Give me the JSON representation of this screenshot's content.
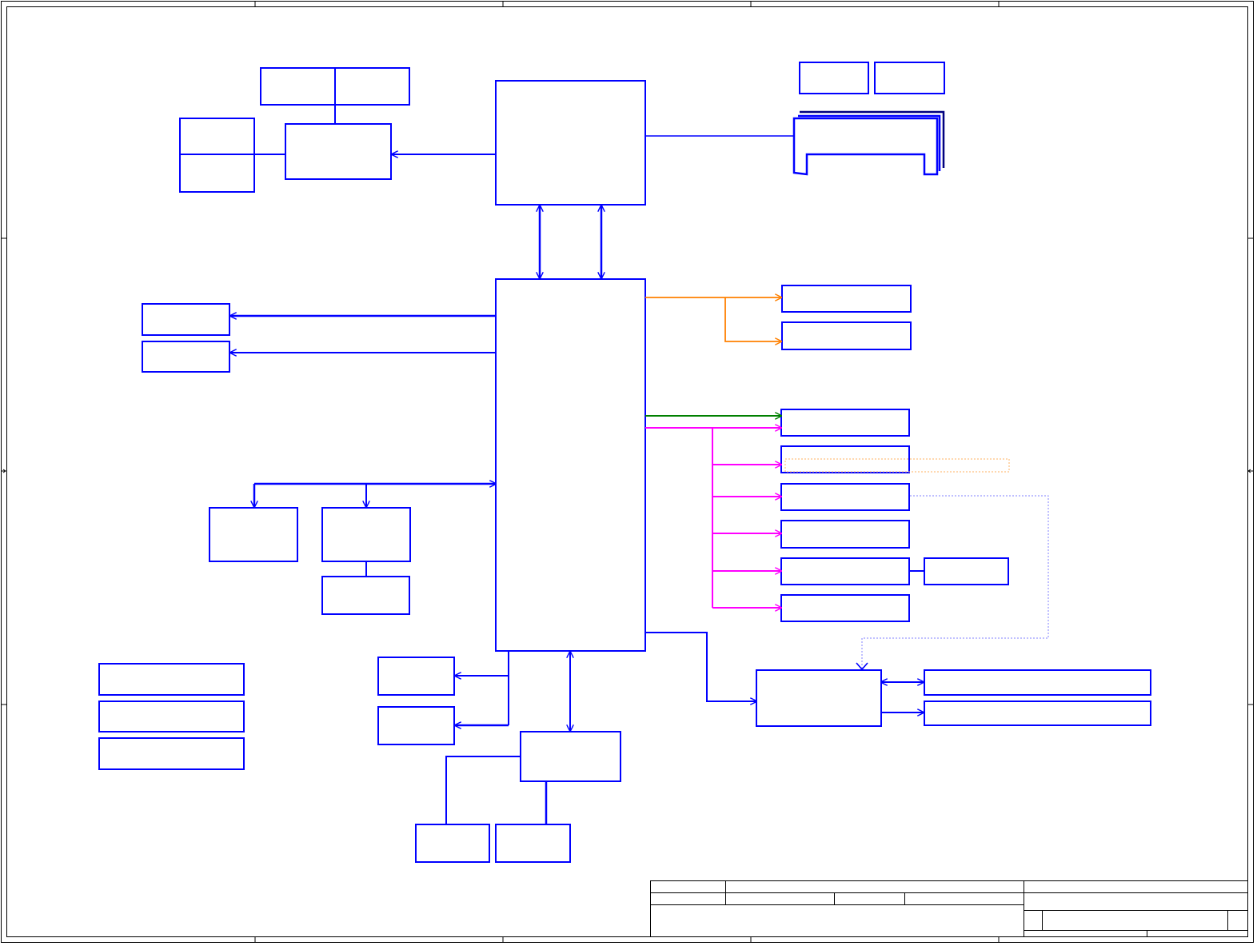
{
  "colors": {
    "frame": "#000000",
    "block": "#0000ff",
    "dark_block": "#000080",
    "orange_bus": "#ff8000",
    "green_bus": "#008000",
    "magenta_bus": "#ff00ff",
    "dotted_link": "#8080ff",
    "dotted_orange": "#ffb060"
  },
  "diagram": {
    "type": "schematic-block-diagram",
    "text_labels": [],
    "blocks": [
      "header-box-top",
      "left-split-block",
      "upper-mid-block",
      "cpu-block",
      "small-block-a",
      "small-block-b",
      "memory-slot-connector",
      "hub-block",
      "left-out-block-1",
      "left-out-block-2",
      "orange-target-1",
      "orange-target-2",
      "green-target",
      "magenta-target-1",
      "magenta-target-2",
      "magenta-target-3",
      "magenta-target-4",
      "magenta-target-5",
      "side-block",
      "magenta-target-6",
      "lower-left-block-1",
      "lower-left-block-2",
      "lower-left-block-3",
      "legend-block-1",
      "legend-block-2",
      "legend-block-3",
      "south-small-1",
      "south-small-2",
      "south-bridge-block",
      "south-bottom-1",
      "south-bottom-2",
      "ec-block",
      "long-block-1",
      "long-block-2"
    ]
  },
  "title_block": {
    "fields": []
  }
}
